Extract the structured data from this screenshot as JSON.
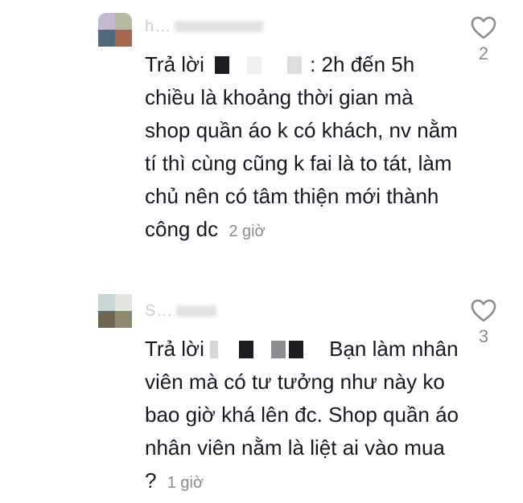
{
  "comments": [
    {
      "username": "h…",
      "reply_prefix": "Trả lời",
      "text": ": 2h đến 5h chiều là khoảng thời gian mà shop quần áo k có khách, nv nằm tí thì cùng cũng k fai là to tát, làm chủ nên có tâm thiện mới thành công dc",
      "time": "2 giờ",
      "likes": "2"
    },
    {
      "username": "S…",
      "reply_prefix": "Trả lời",
      "text": "Bạn làm nhân viên mà có tư tưởng như này ko bao giờ khá lên đc. Shop quần áo nhân viên nằm là liệt ai vào mua ?",
      "time": "1 giờ",
      "likes": "3"
    }
  ],
  "colors": {
    "text": "#161823",
    "secondary": "#8a8b91",
    "heart_outline": "#8a8b91"
  },
  "icons": {
    "like": "heart-outline-icon"
  }
}
